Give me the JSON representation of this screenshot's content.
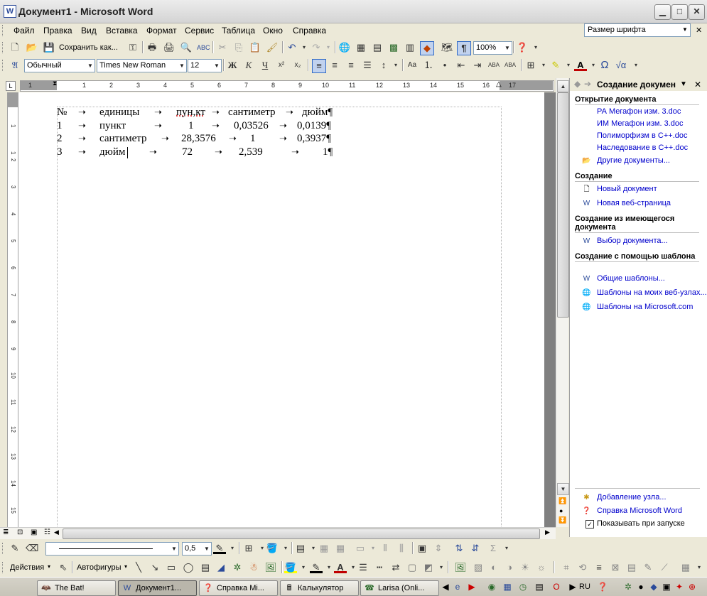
{
  "window": {
    "title": "Документ1 - Microsoft Word",
    "app_icon": "W"
  },
  "menu": {
    "items": [
      "Файл",
      "Правка",
      "Вид",
      "Вставка",
      "Формат",
      "Сервис",
      "Таблица",
      "Окно",
      "Справка"
    ],
    "ask_box": "Размер шрифта"
  },
  "toolbar_standard": {
    "save_label": "Сохранить как...",
    "zoom": "100%"
  },
  "toolbar_format": {
    "style": "Обычный",
    "font": "Times New Roman",
    "size": "12"
  },
  "ruler": {
    "ticks": [
      "1",
      "1",
      "2",
      "3",
      "4",
      "5",
      "6",
      "7",
      "8",
      "9",
      "10",
      "11",
      "12",
      "13",
      "14",
      "15",
      "16",
      "17"
    ]
  },
  "vruler": {
    "ticks": [
      "1",
      "1",
      "2",
      "3",
      "4",
      "5",
      "6",
      "7",
      "8",
      "9",
      "10",
      "11",
      "12",
      "13",
      "14",
      "15"
    ]
  },
  "document": {
    "rows": [
      [
        "№",
        "единицы",
        "пун,кт",
        "сантиметр",
        "дюйм¶"
      ],
      [
        "1",
        "пункт",
        "1",
        "0,03526",
        "0,0139¶"
      ],
      [
        "2",
        "сантиметр",
        "28,3576",
        "1",
        "0,3937¶"
      ],
      [
        "3",
        "дюйм",
        "72",
        "2,539",
        "1¶"
      ]
    ]
  },
  "taskpane": {
    "title": "Создание докумен",
    "sections": {
      "open": "Открытие документа",
      "create": "Создание",
      "from_existing": "Создание из имеющегося документа",
      "from_template": "Создание с помощью шаблона"
    },
    "recent": [
      "РА Мегафон изм. 3.doc",
      "ИМ Мегафон изм. 3.doc",
      "Полиморфизм в C++.doc",
      "Наследование в C++.doc"
    ],
    "other_docs": "Другие документы...",
    "new_doc": "Новый документ",
    "new_web": "Новая веб-страница",
    "choose_doc": "Выбор документа...",
    "templates": [
      "Общие шаблоны...",
      "Шаблоны на моих веб-узлах...",
      "Шаблоны на Microsoft.com"
    ],
    "add_node": "Добавление узла...",
    "help": "Справка Microsoft Word",
    "show_on_start": "Показывать при запуске"
  },
  "drawing_toolbar": {
    "line_weight": "0,5",
    "actions": "Действия",
    "autoshapes": "Автофигуры"
  },
  "taskbar": {
    "tasks": [
      "The Bat!",
      "Документ1...",
      "Справка Mi...",
      "Калькулятор",
      "Larisa (Onli..."
    ],
    "lang": "RU"
  }
}
